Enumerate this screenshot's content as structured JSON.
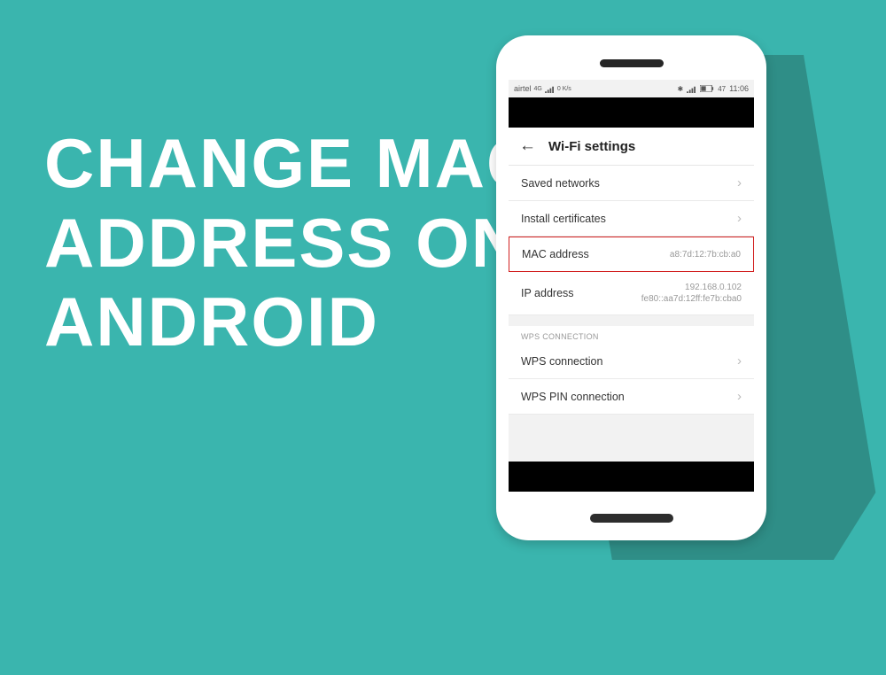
{
  "headline": {
    "line1": "CHANGE MAC",
    "line2": "ADDRESS ON",
    "line3": "ANDROID"
  },
  "status_bar": {
    "carrier": "airtel",
    "net_label": "4G",
    "speed": "0 K/s",
    "bluetooth": "✱",
    "battery": "47",
    "time": "11:06"
  },
  "header": {
    "title": "Wi-Fi settings"
  },
  "rows": {
    "saved_networks": "Saved networks",
    "install_certs": "Install certificates",
    "mac_label": "MAC address",
    "mac_value": "a8:7d:12:7b:cb:a0",
    "ip_label": "IP address",
    "ip_value_1": "192.168.0.102",
    "ip_value_2": "fe80::aa7d:12ff:fe7b:cba0",
    "wps_header": "WPS CONNECTION",
    "wps_conn": "WPS connection",
    "wps_pin": "WPS PIN connection"
  }
}
